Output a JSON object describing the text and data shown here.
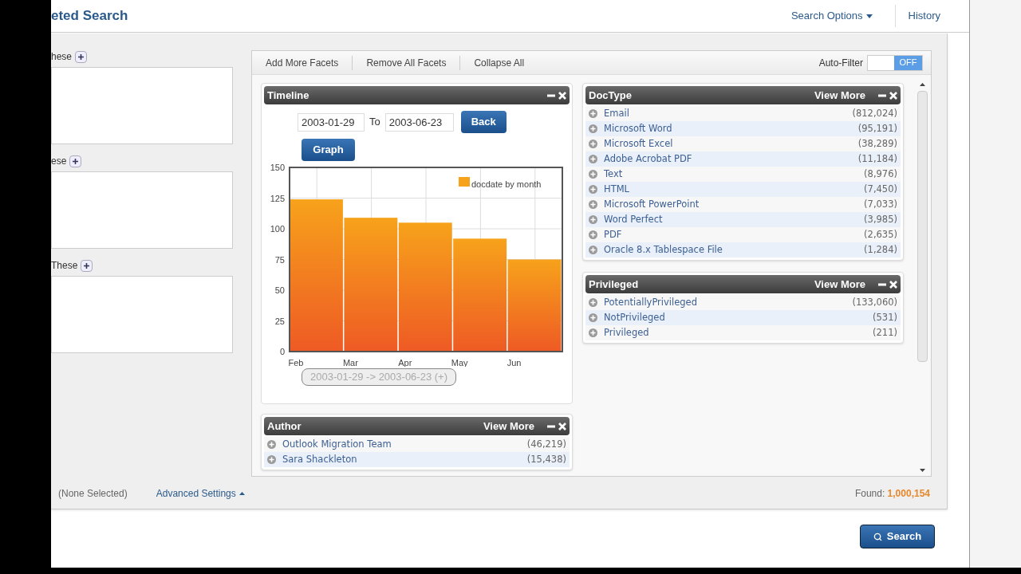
{
  "header": {
    "title": "eted Search",
    "links": [
      {
        "label": "Search Options",
        "kind": "dropdown"
      },
      {
        "label": "History",
        "kind": "link"
      }
    ]
  },
  "filters": [
    {
      "label": "hese"
    },
    {
      "label": "ese"
    },
    {
      "label": "These"
    }
  ],
  "toolbar": {
    "actions": [
      "Add More Facets",
      "Remove All Facets",
      "Collapse All"
    ],
    "auto_filter": {
      "label": "Auto-Filter",
      "on": false,
      "state_text": "OFF"
    }
  },
  "timeline": {
    "title": "Timeline",
    "from": "2003-01-29",
    "to_label": "To",
    "to": "2003-06-23",
    "back_button": "Back",
    "graph_button": "Graph",
    "range_chip": "2003-01-29 -> 2003-06-23 (+)",
    "chart_data": {
      "type": "bar",
      "categories": [
        "Feb",
        "Mar",
        "Apr",
        "May",
        "Jun"
      ],
      "series": [
        {
          "name": "docdate by month",
          "color": "#f7a21b",
          "values": [
            124,
            109,
            105,
            92,
            75
          ]
        }
      ],
      "ylim": [
        0,
        150
      ],
      "grid": true,
      "yticks": [
        0,
        25,
        50,
        75,
        100,
        125,
        150
      ]
    }
  },
  "facets_left": [
    {
      "title": "Author",
      "view_more": "View More",
      "items": [
        {
          "name": "Outlook Migration Team",
          "count": "(46,219)"
        },
        {
          "name": "Sara Shackleton",
          "count": "(15,438)"
        }
      ]
    }
  ],
  "facets_right": [
    {
      "title": "DocType",
      "view_more": "View More",
      "items": [
        {
          "name": "Email",
          "count": "(812,024)"
        },
        {
          "name": "Microsoft Word",
          "count": "(95,191)"
        },
        {
          "name": "Microsoft Excel",
          "count": "(38,289)"
        },
        {
          "name": "Adobe Acrobat PDF",
          "count": "(11,184)"
        },
        {
          "name": "Text",
          "count": "(8,976)"
        },
        {
          "name": "HTML",
          "count": "(7,450)"
        },
        {
          "name": "Microsoft PowerPoint",
          "count": "(7,033)"
        },
        {
          "name": "Word Perfect",
          "count": "(3,985)"
        },
        {
          "name": "PDF",
          "count": "(2,635)"
        },
        {
          "name": "Oracle 8.x Tablespace File",
          "count": "(1,284)"
        }
      ]
    },
    {
      "title": "Privileged",
      "view_more": "View More",
      "items": [
        {
          "name": "PotentiallyPrivileged",
          "count": "(133,060)"
        },
        {
          "name": "NotPrivileged",
          "count": "(531)"
        },
        {
          "name": "Privileged",
          "count": "(211)"
        }
      ]
    }
  ],
  "footer": {
    "selection": "(None Selected)",
    "advanced": "Advanced Settings",
    "found_label": "Found:",
    "found_value": "1,000,154"
  },
  "search_button": "Search"
}
